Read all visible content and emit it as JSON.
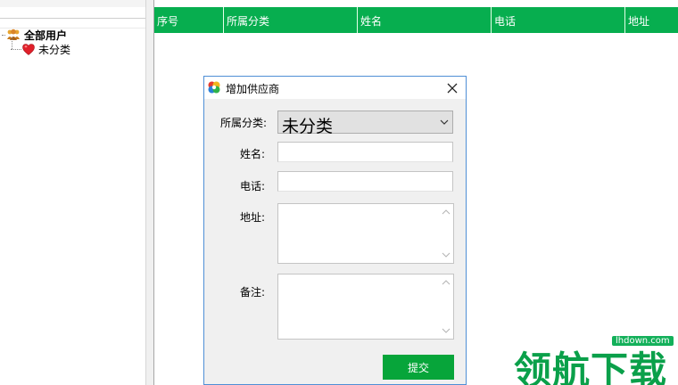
{
  "tree": {
    "root_label": "全部用户",
    "children": [
      {
        "label": "未分类"
      }
    ]
  },
  "grid": {
    "columns": [
      "序号",
      "所属分类",
      "姓名",
      "电话",
      "地址"
    ],
    "header_color": "#07ae4f"
  },
  "dialog": {
    "title": "增加供应商",
    "fields": {
      "category_label": "所属分类:",
      "category_value": "未分类",
      "name_label": "姓名:",
      "name_value": "",
      "phone_label": "电话:",
      "phone_value": "",
      "address_label": "地址:",
      "address_value": "",
      "note_label": "备注:",
      "note_value": ""
    },
    "submit_label": "提交",
    "submit_color": "#07a53a"
  },
  "watermark": {
    "url": "lhdown.com",
    "text": "领航下载"
  },
  "icons": {
    "root": "users-group-icon",
    "child": "heart-icon",
    "app": "app-logo-icon",
    "close": "close-icon",
    "dropdown": "chevron-down-icon"
  }
}
